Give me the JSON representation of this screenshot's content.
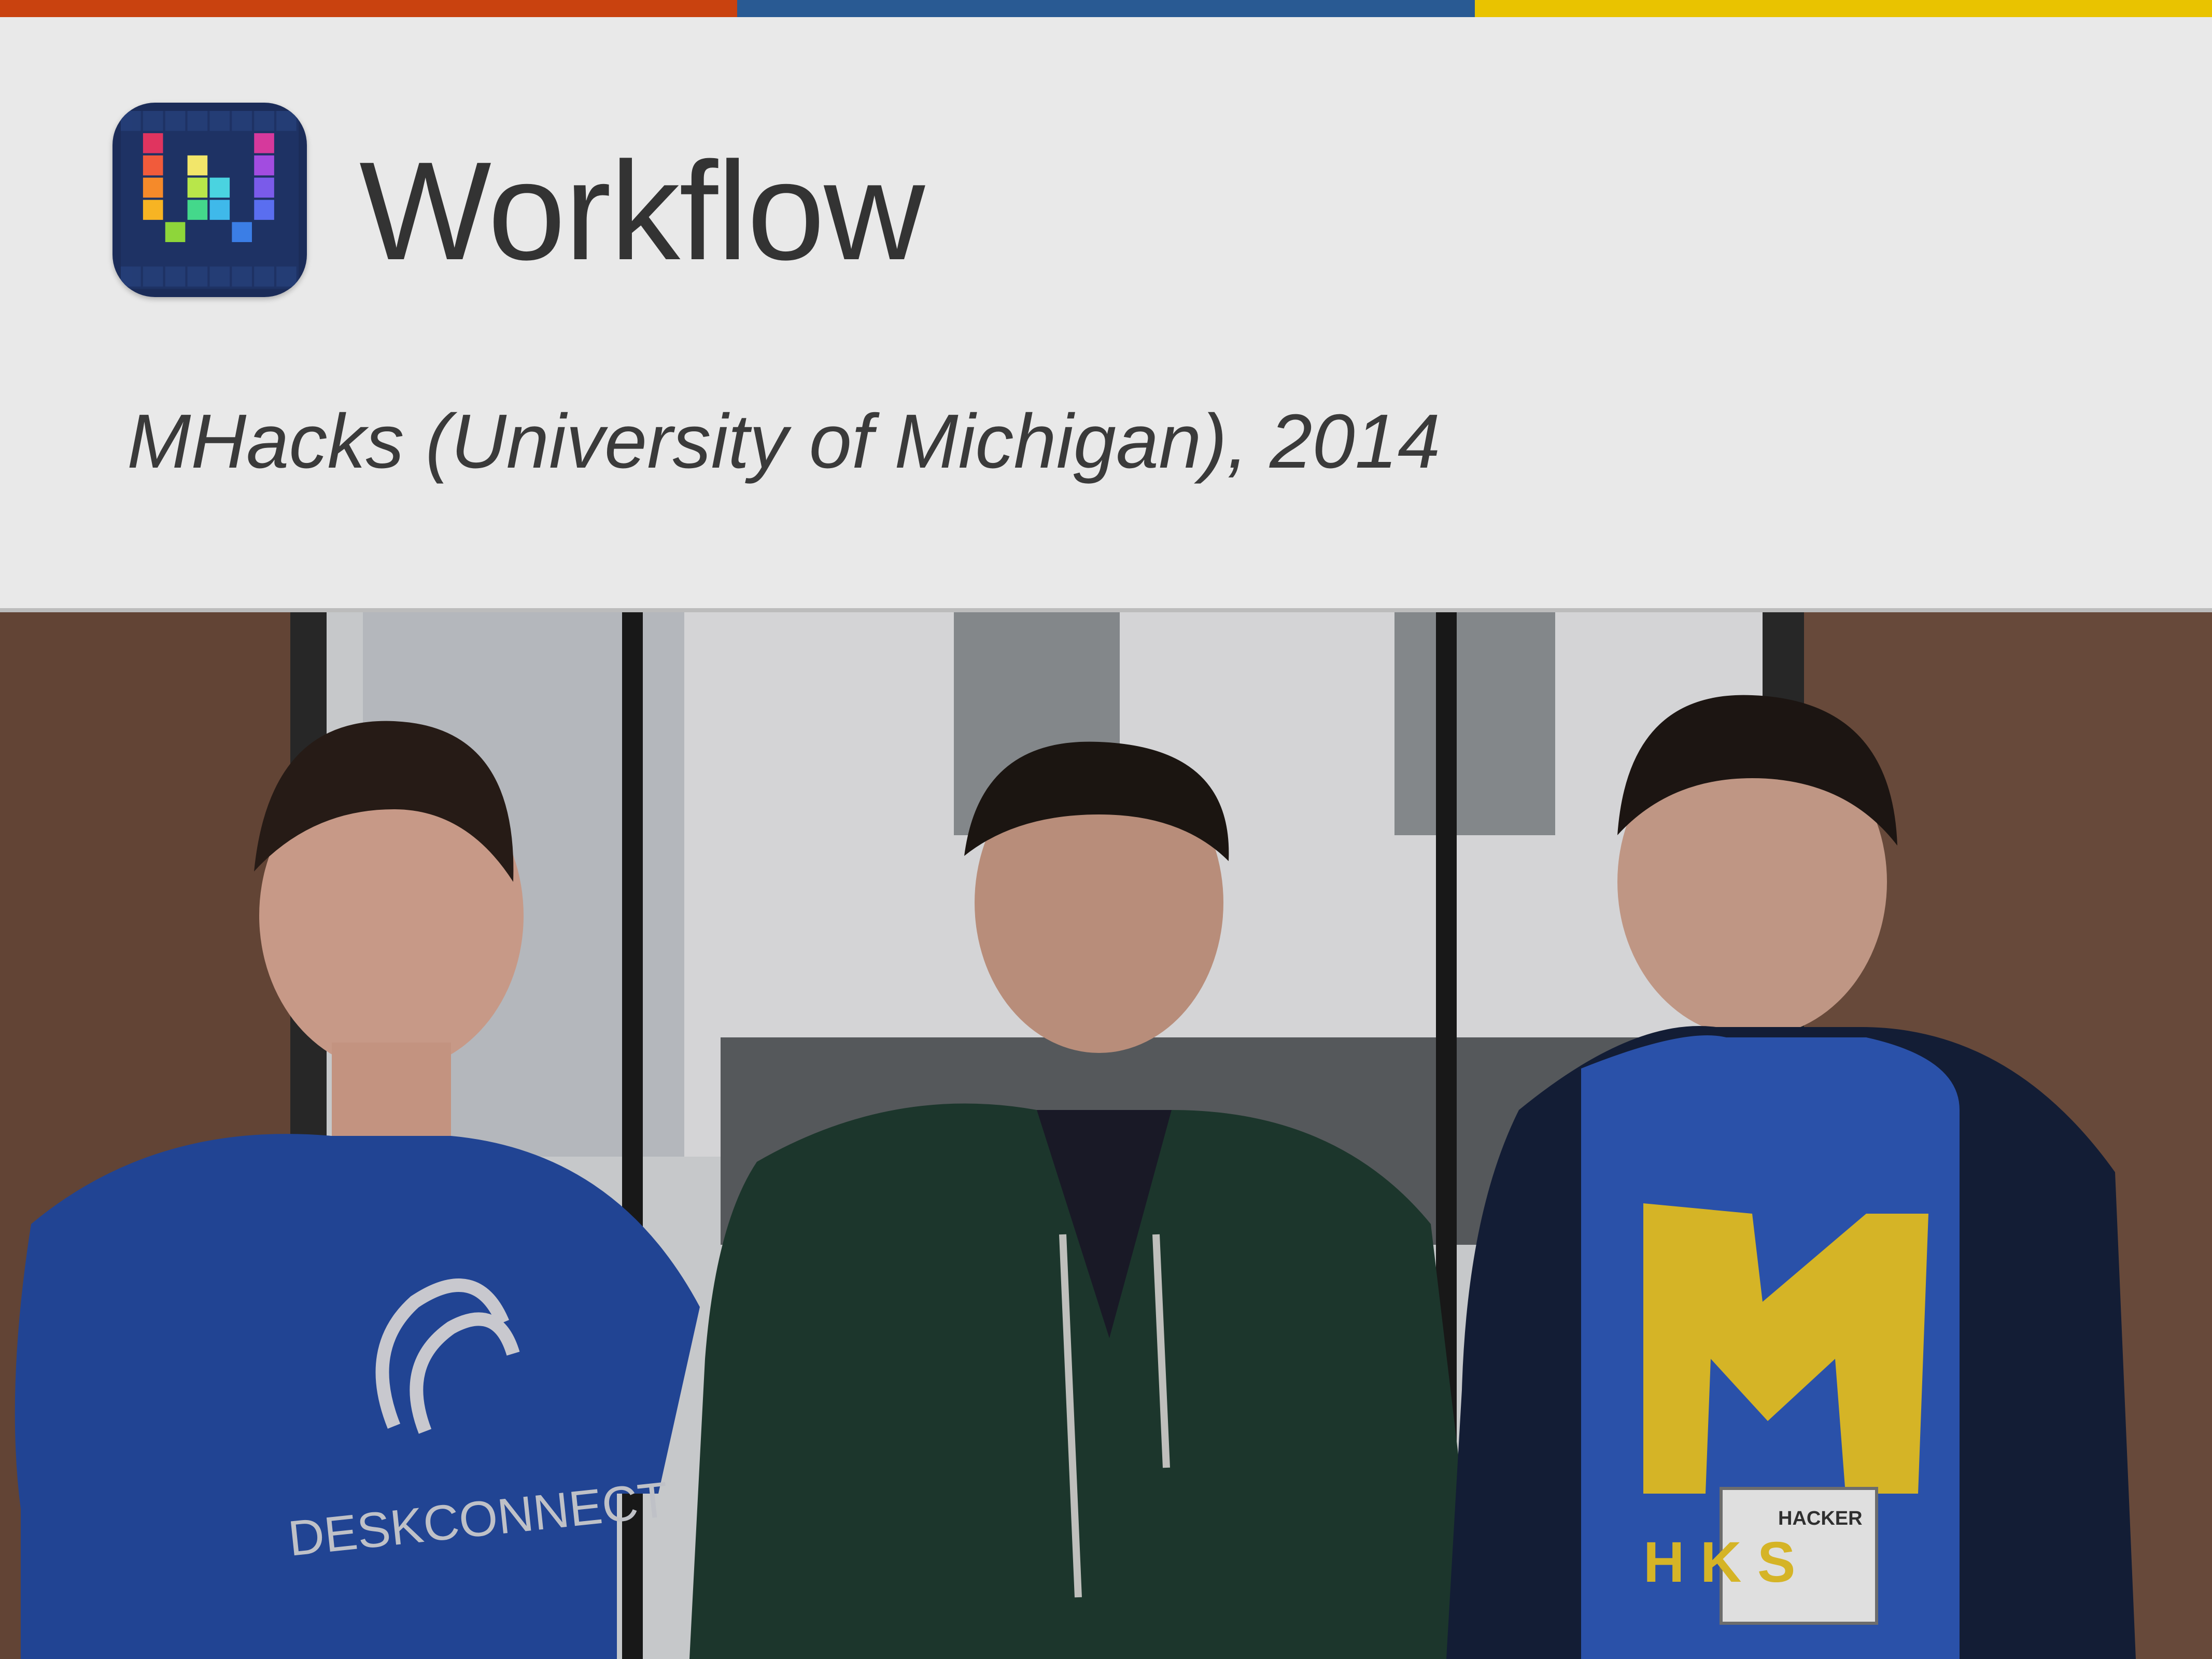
{
  "slide": {
    "title": "Workflow",
    "subtitle": "MHacks (University of Michigan), 2014"
  },
  "accent_colors": [
    "#c9420f",
    "#295a93",
    "#e9c300"
  ],
  "icon": {
    "name": "workflow-app-icon"
  },
  "photo": {
    "shirt_left_text": "DESKCONNECT",
    "shirt_right_text": "H K S",
    "badge_label": "HACKER"
  }
}
